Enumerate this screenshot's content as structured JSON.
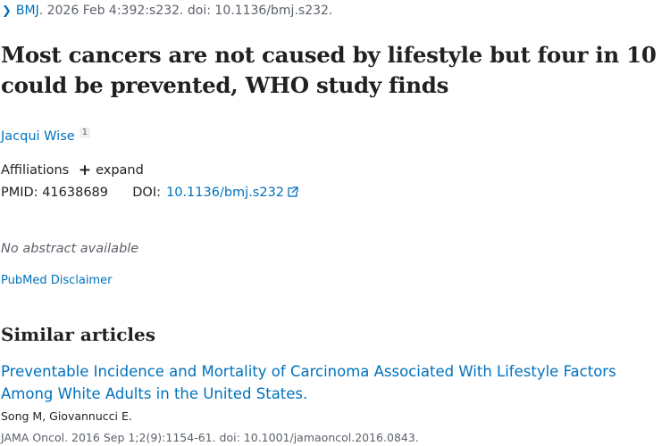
{
  "citation": {
    "journal": "BMJ",
    "details": ". 2026 Feb 4:392:s232. doi: 10.1136/bmj.s232."
  },
  "article": {
    "title_line1": "Most cancers are not caused by lifestyle but four in 10",
    "title_line2": "could be prevented, WHO study finds",
    "author": "Jacqui Wise",
    "author_affiliation_ref": "1",
    "affiliations_label": "Affiliations",
    "expand_label": "expand",
    "pmid_label": "PMID:",
    "pmid": "41638689",
    "doi_label": "DOI:",
    "doi": "10.1136/bmj.s232",
    "no_abstract": "No abstract available",
    "disclaimer": "PubMed Disclaimer"
  },
  "similar": {
    "heading": "Similar articles",
    "items": [
      {
        "title_line1": "Preventable Incidence and Mortality of Carcinoma Associated With Lifestyle Factors",
        "title_line2": "Among White Adults in the United States.",
        "authors": "Song M, Giovannucci E.",
        "source": "JAMA Oncol. 2016 Sep 1;2(9):1154-61. doi: 10.1001/jamaoncol.2016.0843."
      }
    ]
  },
  "icons": {
    "citation_toggle": "chevron-right-icon",
    "expand": "plus-icon",
    "doi_external": "external-link-icon"
  },
  "colors": {
    "link": "#0071bc",
    "text": "#212121",
    "muted": "#5b616b"
  }
}
